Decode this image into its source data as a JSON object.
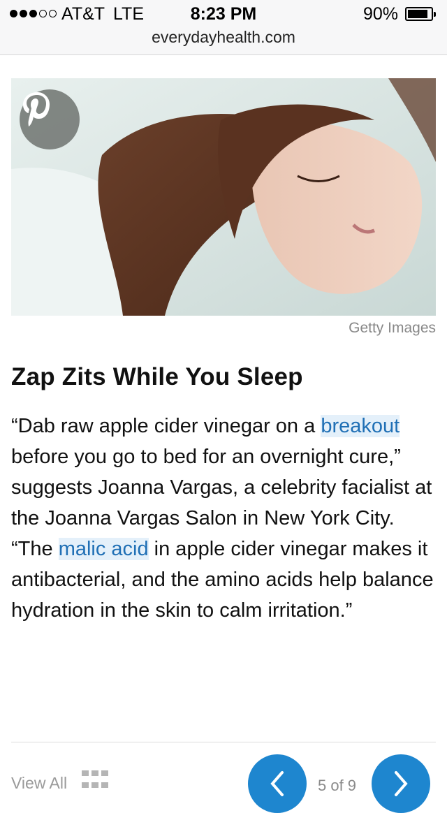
{
  "status_bar": {
    "carrier": "AT&T",
    "network": "LTE",
    "time": "8:23 PM",
    "battery": "90%",
    "signal_bars_filled": 3,
    "signal_bars_total": 5
  },
  "url_bar": {
    "domain": "everydayhealth.com"
  },
  "article": {
    "image_credit": "Getty Images",
    "title": "Zap Zits While You Sleep",
    "paragraph": [
      {
        "text": "“Dab raw apple cider vinegar on a "
      },
      {
        "text": "breakout",
        "link": true
      },
      {
        "text": " before you go to bed for an overnight cure,” suggests Joanna Vargas, a celebrity facialist at the Joanna Vargas Salon in New York City. “The "
      },
      {
        "text": "malic acid",
        "link": true
      },
      {
        "text": " in apple cider vinegar makes it antibacterial, and the amino acids help balance hydration in the skin to calm irritation.”"
      }
    ]
  },
  "footer": {
    "view_all": "View All",
    "pager": "5 of 9"
  },
  "icons": {
    "pinterest": "pinterest-icon",
    "grid": "grid-icon",
    "prev": "chevron-left-icon",
    "next": "chevron-right-icon"
  },
  "colors": {
    "link": "#1f6fb5",
    "link_bg": "#e4f0fa",
    "nav_button": "#1e86cf"
  }
}
